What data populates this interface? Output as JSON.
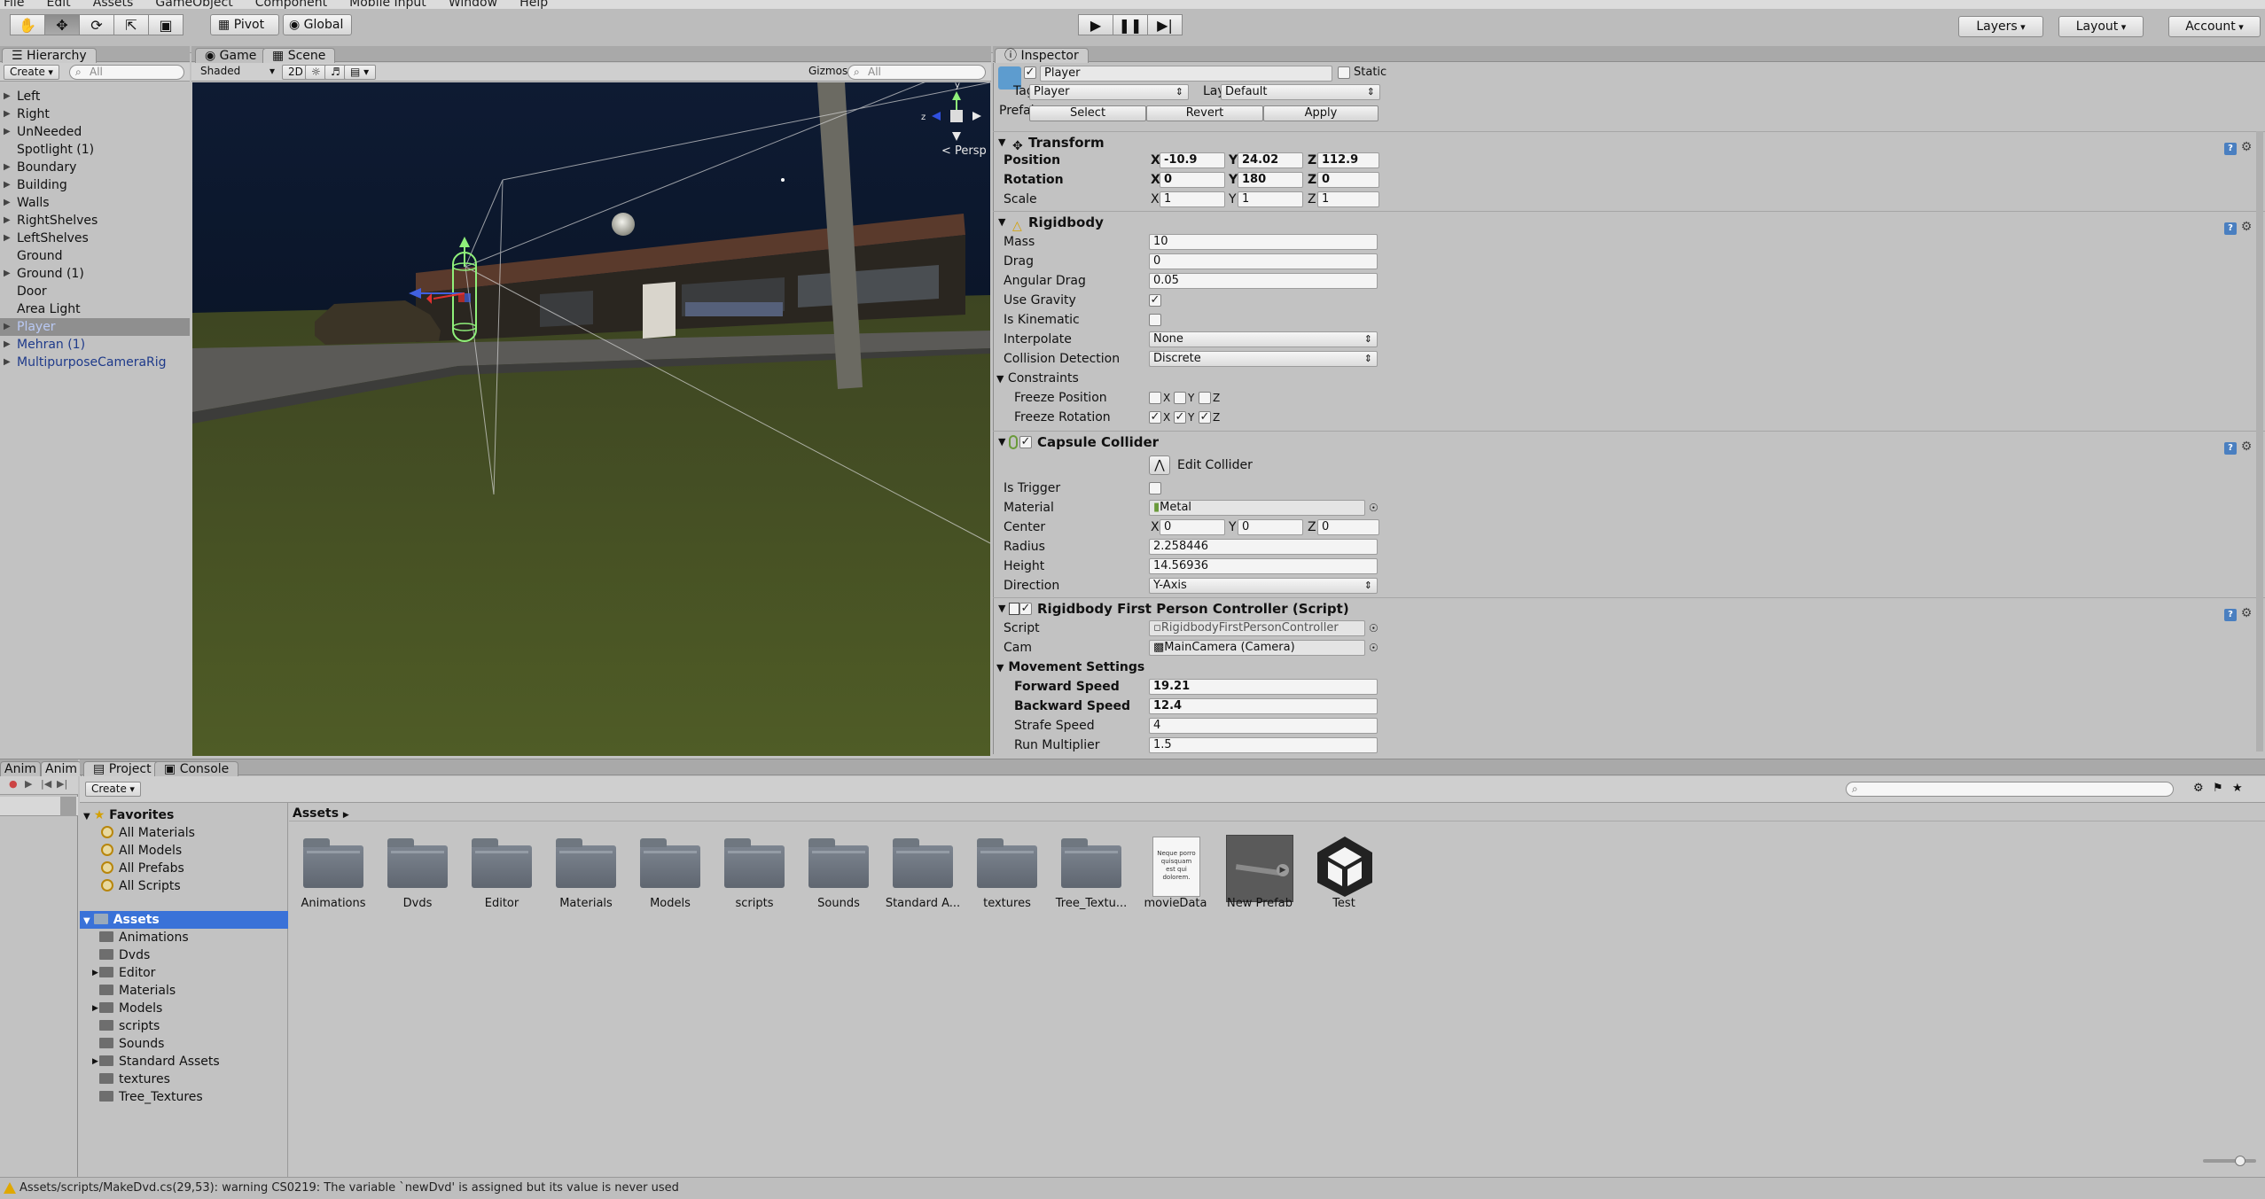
{
  "menubar": {
    "items": [
      "File",
      "Edit",
      "Assets",
      "GameObject",
      "Component",
      "Mobile Input",
      "Window",
      "Help"
    ]
  },
  "toolbar": {
    "tools": [
      "hand",
      "move",
      "rotate",
      "scale",
      "rect"
    ],
    "pivot": "Pivot",
    "global": "Global",
    "layers": "Layers",
    "layout": "Layout",
    "account": "Account"
  },
  "hierarchy": {
    "tab": "Hierarchy",
    "create": "Create",
    "search_placeholder": "All",
    "items": [
      {
        "label": "Left",
        "fold": true
      },
      {
        "label": "Right",
        "fold": true
      },
      {
        "label": "UnNeeded",
        "fold": true
      },
      {
        "label": "Spotlight (1)",
        "fold": false
      },
      {
        "label": "Boundary",
        "fold": true
      },
      {
        "label": "Building",
        "fold": true
      },
      {
        "label": "Walls",
        "fold": true
      },
      {
        "label": "RightShelves",
        "fold": true
      },
      {
        "label": "LeftShelves",
        "fold": true
      },
      {
        "label": "Ground",
        "fold": false
      },
      {
        "label": "Ground (1)",
        "fold": true
      },
      {
        "label": "Door",
        "fold": false
      },
      {
        "label": "Area Light",
        "fold": false
      },
      {
        "label": "Player",
        "fold": true,
        "selected": true,
        "prefab": true
      },
      {
        "label": "Mehran (1)",
        "fold": true,
        "prefab": true
      },
      {
        "label": "MultipurposeCameraRig",
        "fold": true,
        "prefab": true
      }
    ]
  },
  "scene": {
    "tab_game": "Game",
    "tab_scene": "Scene",
    "shading": "Shaded",
    "mode_2d": "2D",
    "gizmos": "Gizmos",
    "search_placeholder": "All",
    "persp": "Persp"
  },
  "inspector": {
    "tab": "Inspector",
    "object_name": "Player",
    "static_label": "Static",
    "tag_label": "Tag",
    "tag_value": "Player",
    "layer_label": "Layer",
    "layer_value": "Default",
    "prefab_label": "Prefab",
    "prefab_select": "Select",
    "prefab_revert": "Revert",
    "prefab_apply": "Apply",
    "transform": {
      "title": "Transform",
      "position_label": "Position",
      "px": "-10.9",
      "py": "24.02",
      "pz": "112.9",
      "rotation_label": "Rotation",
      "rx": "0",
      "ry": "180",
      "rz": "0",
      "scale_label": "Scale",
      "sx": "1",
      "sy": "1",
      "sz": "1"
    },
    "rigidbody": {
      "title": "Rigidbody",
      "mass_label": "Mass",
      "mass": "10",
      "drag_label": "Drag",
      "drag": "0",
      "angular_drag_label": "Angular Drag",
      "angular_drag": "0.05",
      "use_gravity_label": "Use Gravity",
      "is_kinematic_label": "Is Kinematic",
      "interpolate_label": "Interpolate",
      "interpolate": "None",
      "collision_label": "Collision Detection",
      "collision": "Discrete",
      "constraints_label": "Constraints",
      "freeze_pos_label": "Freeze Position",
      "freeze_rot_label": "Freeze Rotation",
      "x": "X",
      "y": "Y",
      "z": "Z"
    },
    "capsule": {
      "title": "Capsule Collider",
      "edit_collider": "Edit Collider",
      "is_trigger_label": "Is Trigger",
      "material_label": "Material",
      "material": "Metal",
      "center_label": "Center",
      "cx": "0",
      "cy": "0",
      "cz": "0",
      "radius_label": "Radius",
      "radius": "2.258446",
      "height_label": "Height",
      "height": "14.56936",
      "direction_label": "Direction",
      "direction": "Y-Axis"
    },
    "script_comp": {
      "title": "Rigidbody First Person Controller (Script)",
      "script_label": "Script",
      "script": "RigidbodyFirstPersonController",
      "cam_label": "Cam",
      "cam": "MainCamera (Camera)",
      "movement_label": "Movement Settings",
      "forward_label": "Forward Speed",
      "forward": "19.21",
      "backward_label": "Backward Speed",
      "backward": "12.4",
      "strafe_label": "Strafe Speed",
      "strafe": "4",
      "run_label": "Run Multiplier",
      "run": "1.5"
    }
  },
  "bottom": {
    "tab_anim1": "Anim",
    "tab_anim2": "Anim",
    "tab_project": "Project",
    "tab_console": "Console",
    "create": "Create",
    "favorites_label": "Favorites",
    "favorites": [
      "All Materials",
      "All Models",
      "All Prefabs",
      "All Scripts"
    ],
    "assets_root": "Assets",
    "assets_tree": [
      {
        "label": "Animations",
        "fold": false
      },
      {
        "label": "Dvds",
        "fold": false
      },
      {
        "label": "Editor",
        "fold": true
      },
      {
        "label": "Materials",
        "fold": false
      },
      {
        "label": "Models",
        "fold": true
      },
      {
        "label": "scripts",
        "fold": false
      },
      {
        "label": "Sounds",
        "fold": false
      },
      {
        "label": "Standard Assets",
        "fold": true
      },
      {
        "label": "textures",
        "fold": false
      },
      {
        "label": "Tree_Textures",
        "fold": false
      }
    ],
    "breadcrumb": "Assets",
    "grid": [
      "Animations",
      "Dvds",
      "Editor",
      "Materials",
      "Models",
      "scripts",
      "Sounds",
      "Standard A...",
      "textures",
      "Tree_Textu...",
      "movieData",
      "New Prefab",
      "Test"
    ],
    "moviedata_text": "Neque porro quisquam est qui dolorem."
  },
  "status": {
    "message": "Assets/scripts/MakeDvd.cs(29,53): warning CS0219: The variable `newDvd' is assigned but its value is never used"
  }
}
